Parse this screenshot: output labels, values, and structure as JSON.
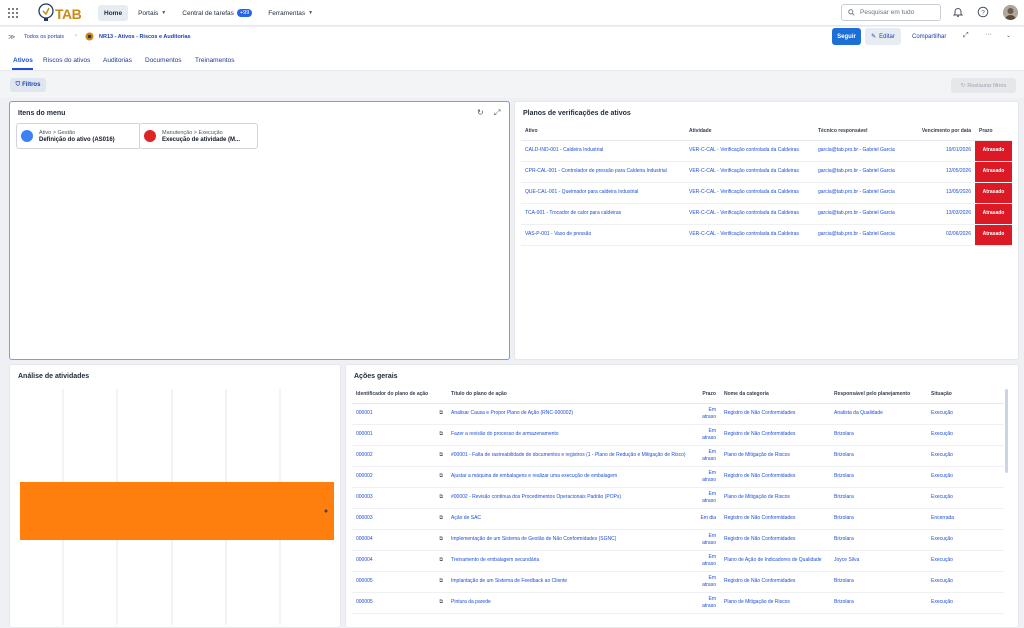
{
  "topbar": {
    "nav": [
      "Home",
      "Portais",
      "Central de tarefas",
      "Ferramentas"
    ],
    "tasks_badge": "+99",
    "search_placeholder": "Pesquisar em tudo"
  },
  "breadcrumb": {
    "root": "Todos os portais",
    "page": "NR13 - Ativos - Riscos e Auditorias"
  },
  "actions": {
    "follow": "Seguir",
    "edit": "Editar",
    "share": "Compartilhar"
  },
  "tabs": [
    "Ativos",
    "Riscos do ativos",
    "Auditorias",
    "Documentos",
    "Treinamentos"
  ],
  "filters": {
    "filter_label": "Filtros",
    "restore_label": "Restaurar filtros"
  },
  "menu_panel": {
    "title": "Itens do menu",
    "items": [
      {
        "path": "Ativo > Gestão",
        "title": "Definição do ativo (AS016)",
        "color": "#3b82f6"
      },
      {
        "path": "Manutenção > Execução",
        "title": "Execução de atividade (M...",
        "color": "#dc2626"
      }
    ]
  },
  "plans_panel": {
    "title": "Planos de verificações de ativos",
    "columns": [
      "Ativo",
      "Atividade",
      "Técnico responsável",
      "Vencimento por data",
      "Prazo"
    ],
    "rows": [
      [
        "CALD-IND-001 - Caldeira Industrial",
        "VER-C-CAL - Verificação controlada da Caldeiras",
        "garcia@tab.pro.br - Gabriel Garcia",
        "19/01/2026",
        "Atrasado"
      ],
      [
        "CPR-CAL-001 - Controlador de pressão para Caldeira Industrial",
        "VER-C-CAL - Verificação controlada da Caldeiras",
        "garcia@tab.pro.br - Gabriel Garcia",
        "13/05/2026",
        "Atrasado"
      ],
      [
        "QUE-CAL-001 - Queimador para caldeira Industrial",
        "VER-C-CAL - Verificação controlada da Caldeiras",
        "garcia@tab.pro.br - Gabriel Garcia",
        "13/05/2026",
        "Atrasado"
      ],
      [
        "TCA-001 - Trocador de calor para caldeiras",
        "VER-C-CAL - Verificação controlada da Caldeiras",
        "garcia@tab.pro.br - Gabriel Garcia",
        "13/03/2026",
        "Atrasado"
      ],
      [
        "VAS-P-001 - Vaso de pressão",
        "VER-C-CAL - Verificação controlada da Caldeiras",
        "garcia@tab.pro.br - Gabriel Garcia",
        "02/06/2026",
        "Atrasado"
      ]
    ]
  },
  "analysis_panel": {
    "title": "Análise de atividades"
  },
  "chart_data": {
    "type": "bar",
    "orientation": "horizontal",
    "categories": [
      ""
    ],
    "values": [
      6
    ],
    "xlim": [
      0,
      6
    ],
    "grid": true,
    "bar_color": "#ff7f0e",
    "gridlines": 6
  },
  "actions_panel": {
    "title": "Ações gerais",
    "columns": [
      "Identificador do plano de ação",
      "Título do plano de ação",
      "Prazo",
      "Nome da categoria",
      "Responsável pelo planejamento",
      "Situação"
    ],
    "rows": [
      [
        "000001",
        "Analisar Causa e Propor Plano de Ação (RNC-000002)",
        "Em atraso",
        "Registro de Não Conformidades",
        "Analista da Qualidade",
        "Execução"
      ],
      [
        "000001",
        "Fazer a revisão do processo de armazenamento",
        "Em atraso",
        "Registro de Não Conformidades",
        "Brizolara",
        "Execução"
      ],
      [
        "000002",
        "#00001 - Falta de rastreabilidade de documentos e registros (1 - Plano de Redução e Mitigação de Risco)",
        "Em atraso",
        "Plano de Mitigação de Riscos",
        "Brizolara",
        "Execução"
      ],
      [
        "000002",
        "Ajustar a máquina de embalagens e realizar uma execução de embalagem",
        "Em atraso",
        "Registro de Não Conformidades",
        "Brizolara",
        "Execução"
      ],
      [
        "000003",
        "#00002 - Revisão contínua dos Procedimentos Operacionais Padrão (POPs)",
        "Em atraso",
        "Plano de Mitigação de Riscos",
        "Brizolara",
        "Execução"
      ],
      [
        "000003",
        "Ação de SAC",
        "Em dia",
        "Registro de Não Conformidades",
        "Brizolara",
        "Encerrada"
      ],
      [
        "000004",
        "Implementação de um Sistema de Gestão de Não Conformidades (SGNC)",
        "Em atraso",
        "Registro de Não Conformidades",
        "Brizolara",
        "Execução"
      ],
      [
        "000004",
        "Treinamento de embalagem secundária",
        "Em atraso",
        "Plano de Ação de Indicadores de Qualidade",
        "Joyce Silva",
        "Execução"
      ],
      [
        "000005",
        "Implantação de um Sistema de Feedback ao Cliente",
        "Em atraso",
        "Registro de Não Conformidades",
        "Brizolara",
        "Execução"
      ],
      [
        "000005",
        "Pintura da parede",
        "Em atraso",
        "Plano de Mitigação de Riscos",
        "Brizolara",
        "Execução"
      ]
    ]
  }
}
